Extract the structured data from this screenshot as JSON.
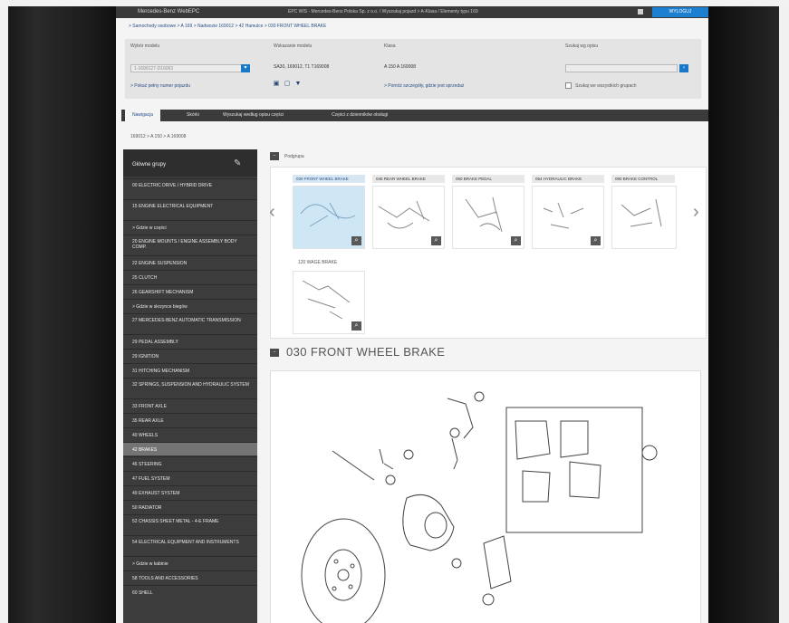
{
  "titlebar": {
    "left_text": "Mercedes-Benz WebEPC",
    "center_text": "EPC WIS - Mercedes-Benz Polska Sp. z o.o. / Wyszukaj pojazd > A-Klasa / Elementy typu 169",
    "right_label": "WYLOGUJ"
  },
  "breadcrumb": "> Samochody osobowe > A 169 > Nadwozie 169012 > 42 Hamulce > 030 FRONT WHEEL BRAKE",
  "filters": {
    "vehicle": {
      "label": "Wybór modelu",
      "value": "1-1690127-D16063",
      "link": "> Pokaż pełny numer pojazdu"
    },
    "identification": {
      "label": "Wskazanie modelu",
      "value": "SA30, 169012, T1 T169008"
    },
    "class": {
      "label": "Klasa",
      "value": "A 150 A 169008",
      "link": "> Pomóż szczegóły, gdzie jest sprzedaż"
    },
    "search": {
      "label": "Szukaj wg opisu",
      "placeholder": "",
      "checkbox_label": "Szukaj we wszystkich grupach"
    }
  },
  "tabs": [
    "Nawigacja",
    "Skórki",
    "Wyszukaj według opisu części",
    "Części z dzienników obsługi"
  ],
  "path_text": "169012 > A 150 > A 169008",
  "sidebar": {
    "title": "Główne grupy",
    "items": [
      "00 ELECTRIC DRIVE / HYBRID DRIVE",
      "15 ENGINE ELECTRICAL EQUIPMENT",
      "> Gdzie w części",
      "20 ENGINE MOUNTS / ENGINE ASSEMBLY BODY COMP.",
      "22 ENGINE SUSPENSION",
      "25 CLUTCH",
      "26 GEARSHIFT MECHANISM",
      "> Gdzie w skrzynce biegów",
      "27 MERCEDES-BENZ AUTOMATIC TRANSMISSION",
      "29 PEDAL ASSEMBLY",
      "29 IGNITION",
      "31 HITCHING MECHANISM",
      "32 SPRINGS, SUSPENSION AND HYDRAULIC SYSTEM",
      "33 FRONT AXLE",
      "35 REAR AXLE",
      "40 WHEELS",
      "42 BRAKES",
      "46 STEERING",
      "47 FUEL SYSTEM",
      "49 EXHAUST SYSTEM",
      "50 RADIATOR",
      "52 CHASSIS SHEET METAL - 4-E FRAME",
      "54 ELECTRICAL EQUIPMENT AND INSTRUMENTS",
      "> Gdzie w kabinie",
      "58 TOOLS AND ACCESSORIES",
      "60 SHELL"
    ],
    "selected_index": 16
  },
  "subgroups": {
    "header": "Podgrupa",
    "thumbnails": [
      "030 FRONT WHEEL BRAKE",
      "045 REAR WHEEL BRAKE",
      "050 BRAKE PEDAL",
      "054 HYDRAULIC BRAKE",
      "090 BRAKE CONTROL"
    ],
    "second_row_label": "120 WAGE BRAKE"
  },
  "section_title": "030 FRONT WHEEL BRAKE"
}
